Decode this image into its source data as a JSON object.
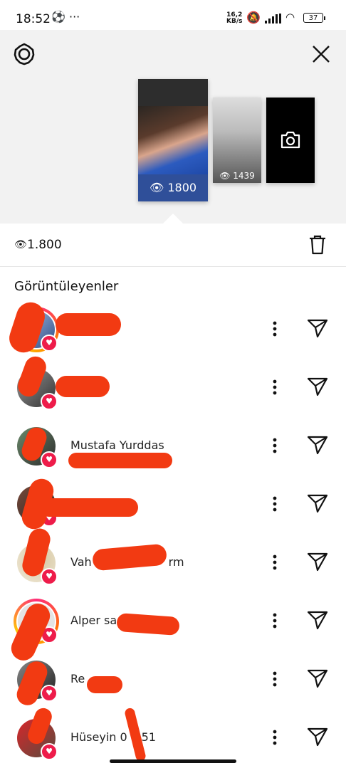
{
  "status_bar": {
    "time": "18:52",
    "icons": "⚽ ···",
    "network_speed_top": "16,2",
    "network_speed_unit": "KB/s",
    "battery": "37"
  },
  "header": {
    "settings_icon": "gear-icon",
    "close_icon": "close-icon"
  },
  "stories": [
    {
      "views": "1800",
      "selected": true
    },
    {
      "views": "1439",
      "selected": false
    },
    {
      "label": "camera-icon",
      "selected": false
    }
  ],
  "viewer_summary": {
    "view_count": "1.800",
    "delete_icon": "trash-icon"
  },
  "viewers_heading": "Görüntüleyenler",
  "viewers": [
    {
      "name": "",
      "ring": true
    },
    {
      "name": "",
      "ring": false
    },
    {
      "name": "Mustafa Yurddas",
      "ring": false
    },
    {
      "name": "",
      "ring": false
    },
    {
      "name": "Vah",
      "name_tail": "rm",
      "ring": false
    },
    {
      "name": "Alper sa",
      "ring": true
    },
    {
      "name": "Re",
      "ring": false
    },
    {
      "name": "Hüseyin 0",
      "name_tail": "51",
      "ring": false
    }
  ],
  "colors": {
    "accent_bar": "#2f4f99",
    "heart": "#ee1c4a",
    "redaction": "#f23a12"
  }
}
